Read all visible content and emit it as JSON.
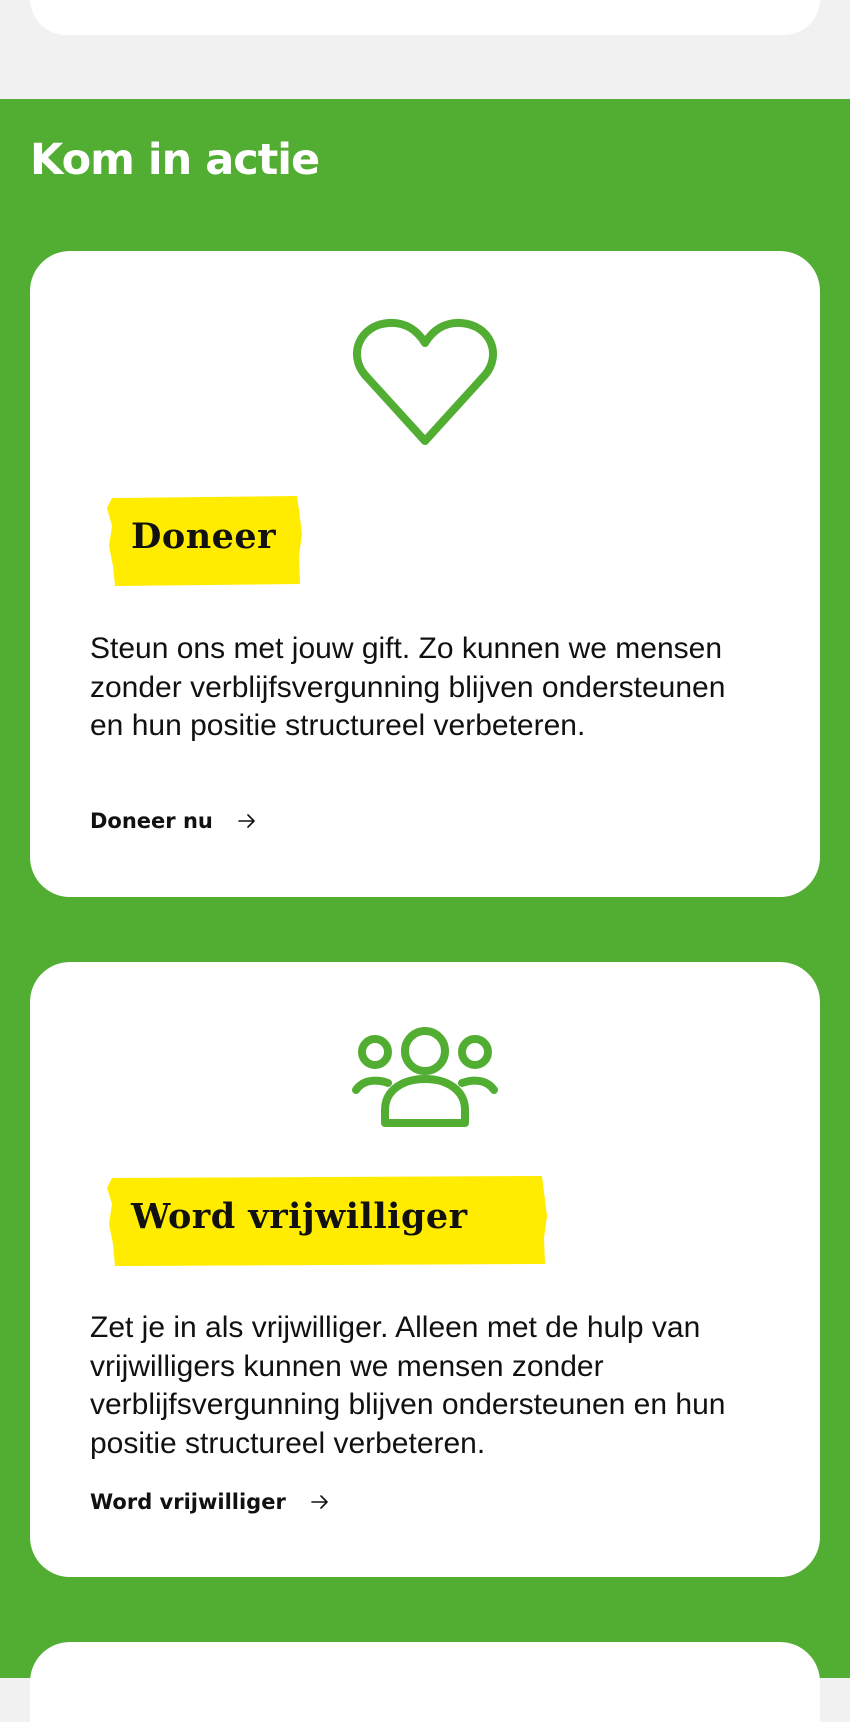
{
  "section": {
    "title": "Kom in actie"
  },
  "cards": [
    {
      "icon": "heart-icon",
      "heading": "Doneer",
      "text": "Steun ons met jouw gift. Zo kunnen we mensen zonder verblijfsvergunning blijven ondersteunen en hun positie structureel verbeteren.",
      "link_label": "Doneer nu",
      "link_icon": "arrow-right-icon"
    },
    {
      "icon": "people-group-icon",
      "heading": "Word vrijwilliger",
      "text": "Zet je in als vrijwilliger. Alleen met de hulp van vrijwilligers kunnen we mensen zonder verblijfsvergunning blijven ondersteunen en hun positie structureel verbeteren.",
      "link_label": "Word vrijwilliger",
      "link_icon": "arrow-right-icon"
    }
  ],
  "colors": {
    "section_background": "#52ae33",
    "icon_green": "#52ae33",
    "highlight_yellow": "#ffec00",
    "card_background": "#ffffff",
    "page_background": "#f1f1f1",
    "text": "#111111"
  }
}
